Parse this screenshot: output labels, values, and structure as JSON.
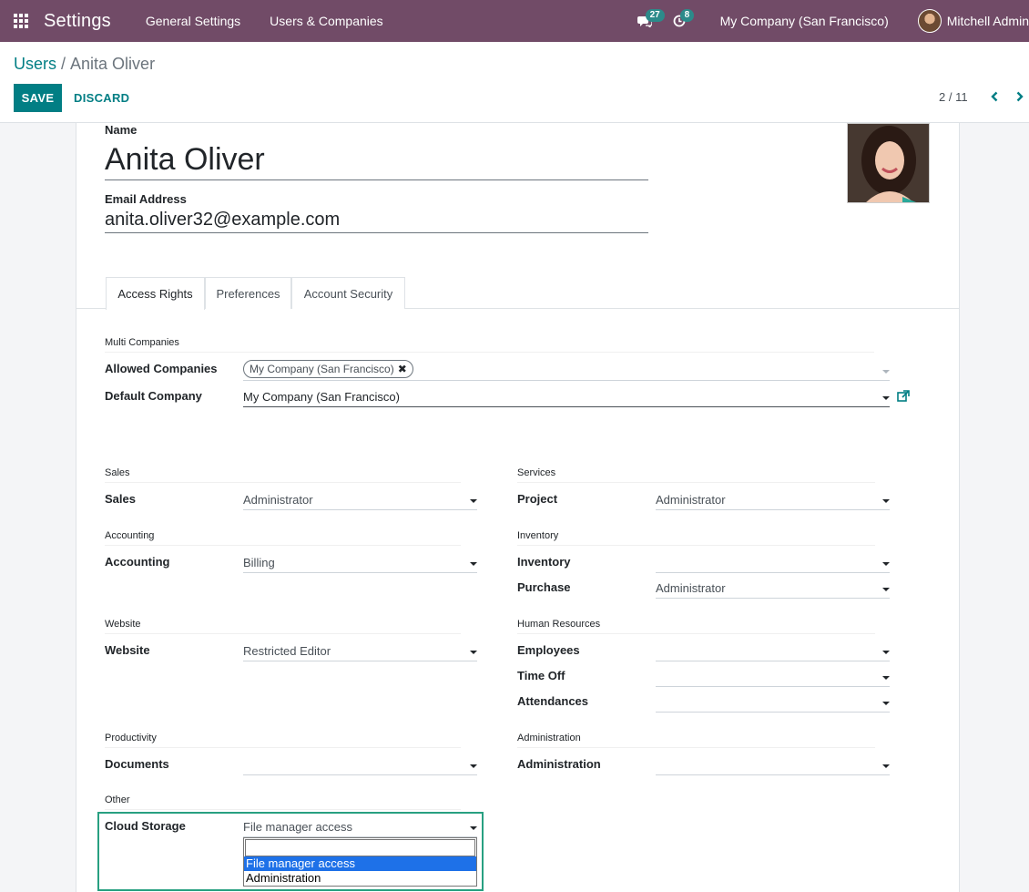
{
  "navbar": {
    "app_title": "Settings",
    "menus": [
      "General Settings",
      "Users & Companies"
    ],
    "messages_count": "27",
    "activities_count": "8",
    "company": "My Company (San Francisco)",
    "user_name": "Mitchell Admin",
    "color": "#714B67"
  },
  "control_panel": {
    "breadcrumb_parent": "Users",
    "breadcrumb_separator": "/",
    "breadcrumb_current": "Anita Oliver",
    "save_label": "SAVE",
    "discard_label": "DISCARD",
    "pager": "2 / 11"
  },
  "form": {
    "name_label": "Name",
    "name_value": "Anita Oliver",
    "email_label": "Email Address",
    "email_value": "anita.oliver32@example.com",
    "tabs": [
      "Access Rights",
      "Preferences",
      "Account Security"
    ],
    "multi_companies": {
      "title": "Multi Companies",
      "allowed_label": "Allowed Companies",
      "allowed_tag": "My Company (San Francisco)",
      "default_label": "Default Company",
      "default_value": "My Company (San Francisco)"
    },
    "sales": {
      "title": "Sales",
      "label": "Sales",
      "value": "Administrator"
    },
    "services": {
      "title": "Services",
      "label": "Project",
      "value": "Administrator"
    },
    "accounting": {
      "title": "Accounting",
      "label": "Accounting",
      "value": "Billing"
    },
    "inventory": {
      "title": "Inventory",
      "label": "Inventory",
      "value": "",
      "purchase_label": "Purchase",
      "purchase_value": "Administrator"
    },
    "website": {
      "title": "Website",
      "label": "Website",
      "value": "Restricted Editor"
    },
    "human_resources": {
      "title": "Human Resources",
      "employees_label": "Employees",
      "employees_value": "",
      "timeoff_label": "Time Off",
      "timeoff_value": "",
      "attendances_label": "Attendances",
      "attendances_value": ""
    },
    "productivity": {
      "title": "Productivity",
      "label": "Documents",
      "value": ""
    },
    "administration": {
      "title": "Administration",
      "label": "Administration",
      "value": ""
    },
    "other": {
      "title": "Other",
      "label": "Cloud Storage",
      "value": "File manager access",
      "options": [
        "File manager access",
        "Administration"
      ]
    }
  }
}
